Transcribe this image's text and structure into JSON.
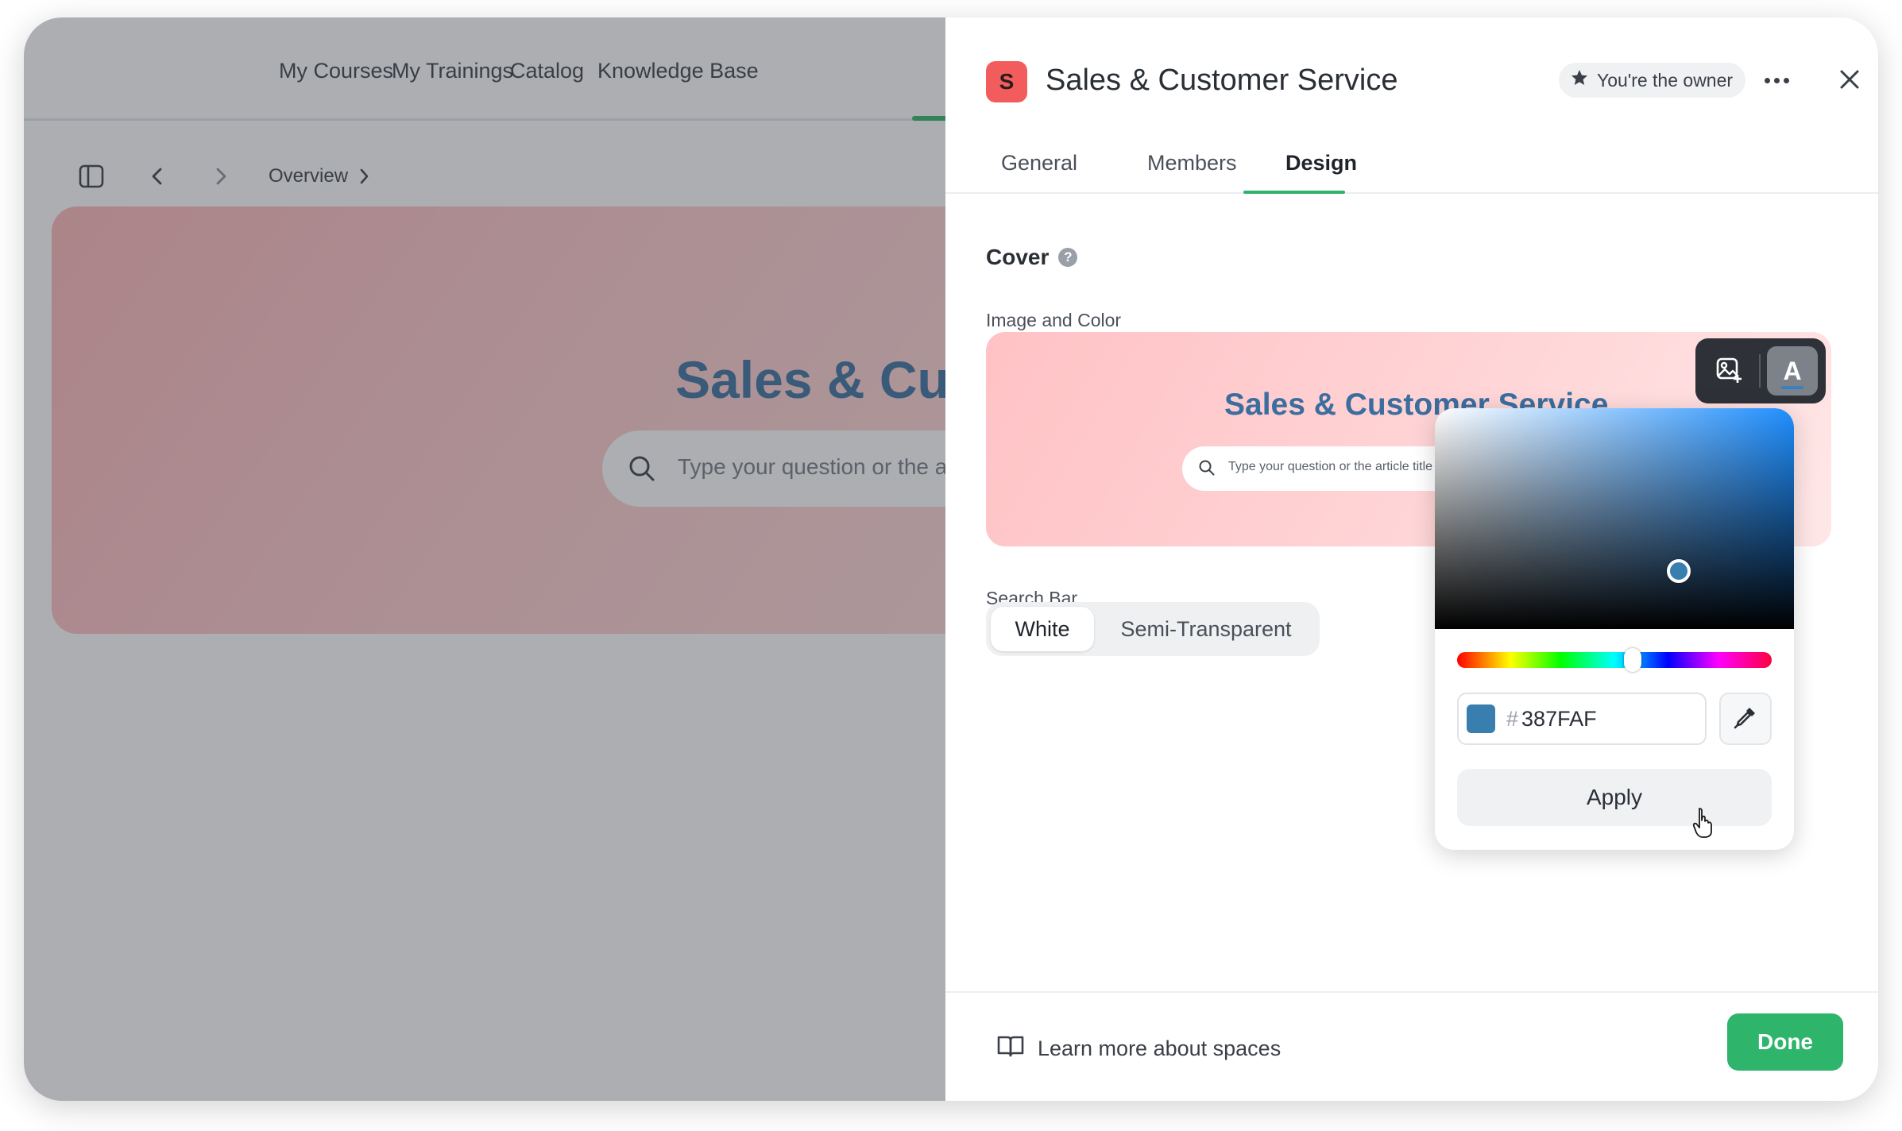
{
  "background_app": {
    "nav": [
      "My Courses",
      "My Trainings",
      "Catalog",
      "Knowledge Base"
    ],
    "breadcrumb": "Overview",
    "hero_title": "Sales & Customer Service",
    "search_placeholder": "Type your question or the article title"
  },
  "panel": {
    "badge_letter": "S",
    "title": "Sales & Customer Service",
    "owner_label": "You're the owner",
    "tabs": [
      "General",
      "Members",
      "Design"
    ],
    "active_tab": "Design",
    "cover": {
      "section_title": "Cover",
      "image_color_label": "Image and Color",
      "preview_title": "Sales & Customer Service",
      "preview_search_placeholder": "Type your question or the article title",
      "text_color_tool_letter": "A"
    },
    "search_bar": {
      "label": "Search Bar",
      "options": [
        "White",
        "Semi-Transparent"
      ],
      "selected": "White"
    },
    "color_picker": {
      "hash": "#",
      "hex_value": "387FAF",
      "apply_label": "Apply"
    },
    "footer": {
      "learn_more": "Learn more about spaces",
      "done_label": "Done"
    }
  },
  "colors": {
    "accent_green": "#2eb56b",
    "selected_color": "#387faf",
    "badge_red": "#f25c5c"
  }
}
